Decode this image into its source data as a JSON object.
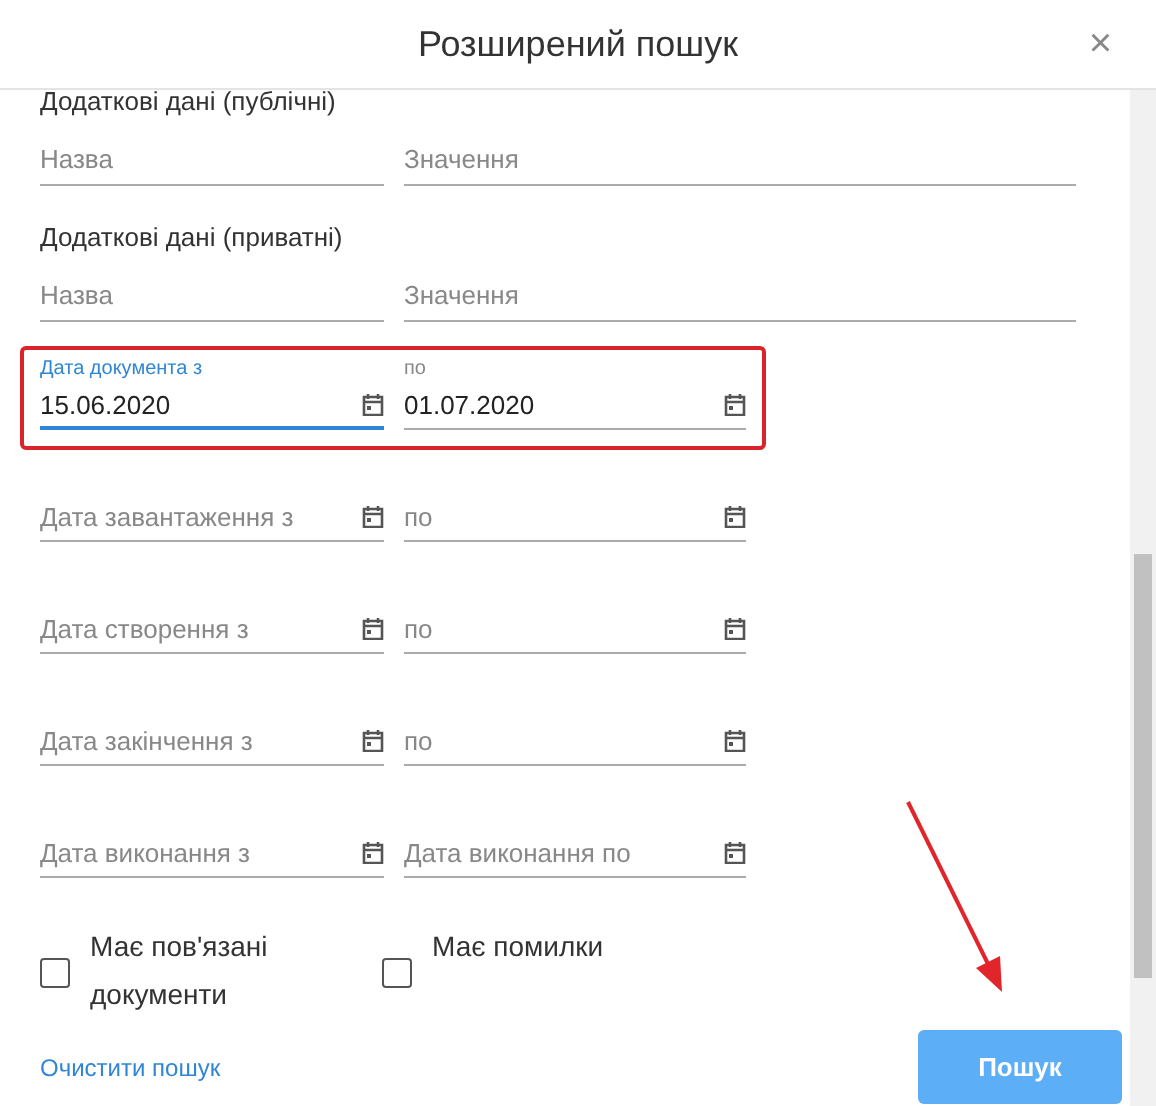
{
  "window": {
    "title": "Розширений пошук",
    "close": "×"
  },
  "sections": [
    {
      "title": "Додаткові дані (публічні)",
      "fields": [
        {
          "placeholder": "Назва"
        },
        {
          "placeholder": "Значення"
        }
      ]
    },
    {
      "title": "Додаткові дані (приватні)",
      "fields": [
        {
          "placeholder": "Назва"
        },
        {
          "placeholder": "Значення"
        }
      ]
    }
  ],
  "date_ranges": [
    {
      "highlighted": true,
      "from": {
        "label": "Дата документа з",
        "value": "15.06.2020",
        "focused": true
      },
      "to": {
        "label": "по",
        "value": "01.07.2020",
        "focused": false
      }
    },
    {
      "highlighted": false,
      "from": {
        "placeholder": "Дата завантаження з"
      },
      "to": {
        "placeholder": "по"
      }
    },
    {
      "highlighted": false,
      "from": {
        "placeholder": "Дата створення з"
      },
      "to": {
        "placeholder": "по"
      }
    },
    {
      "highlighted": false,
      "from": {
        "placeholder": "Дата закінчення з"
      },
      "to": {
        "placeholder": "по"
      }
    },
    {
      "highlighted": false,
      "from": {
        "placeholder": "Дата виконання з"
      },
      "to": {
        "placeholder": "Дата виконання по"
      }
    }
  ],
  "checkboxes": [
    {
      "label": "Має пов'язані документи",
      "checked": false
    },
    {
      "label": "Має помилки",
      "checked": false
    }
  ],
  "clear_link": "Очистити пошук",
  "search_button": "Пошук"
}
